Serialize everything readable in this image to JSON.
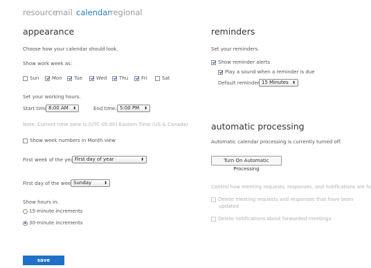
{
  "tabs": [
    "resource",
    "mail",
    "calendar",
    "regional"
  ],
  "active_tab": "calendar",
  "appearance": {
    "title": "appearance",
    "description": "Choose how your calendar should look.",
    "work_week_label": "Show work week as:",
    "days": [
      {
        "label": "Sun",
        "checked": false
      },
      {
        "label": "Mon",
        "checked": true
      },
      {
        "label": "Tue",
        "checked": true
      },
      {
        "label": "Wed",
        "checked": true
      },
      {
        "label": "Thu",
        "checked": true
      },
      {
        "label": "Fri",
        "checked": true
      },
      {
        "label": "Sat",
        "checked": false
      }
    ],
    "working_hours_label": "Set your working hours.",
    "start_time_label": "Start time:",
    "start_time_value": "8:00 AM",
    "end_time_label": "End time:",
    "end_time_value": "5:00 PM",
    "timezone_note": "Note: Current time zone is (UTC-05:00) Eastern Time (US & Canada)",
    "week_numbers_label": "Show week numbers in Month view",
    "week_numbers_checked": false,
    "first_week_label": "First week of the year:",
    "first_week_value": "First day of year",
    "first_day_label": "First day of the week:",
    "first_day_value": "Sunday",
    "hours_in_label": "Show hours in:",
    "hours_options": [
      {
        "label": "15-minute increments",
        "checked": false
      },
      {
        "label": "30-minute increments",
        "checked": true
      }
    ]
  },
  "reminders": {
    "title": "reminders",
    "description": "Set your reminders.",
    "show_alerts_label": "Show reminder alerts",
    "show_alerts_checked": true,
    "play_sound_label": "Play a sound when a reminder is due",
    "play_sound_checked": true,
    "default_reminder_label": "Default reminder:",
    "default_reminder_value": "15 Minutes"
  },
  "automatic_processing": {
    "title": "automatic processing",
    "status_text": "Automatic calendar processing is currently turned off.",
    "turn_on_button": "Turn On Automatic Processing",
    "control_text": "Control how meeting requests, responses, and notifications are handled.",
    "delete_requests_label_line1": "Delete meeting requests and responses that have been",
    "delete_requests_label_line2": "updated",
    "delete_notifications_label": "Delete notifications about forwarded meetings"
  },
  "save_label": "save",
  "colors": {
    "accent": "#1f7bc6",
    "save_button": "#1e70c9"
  }
}
